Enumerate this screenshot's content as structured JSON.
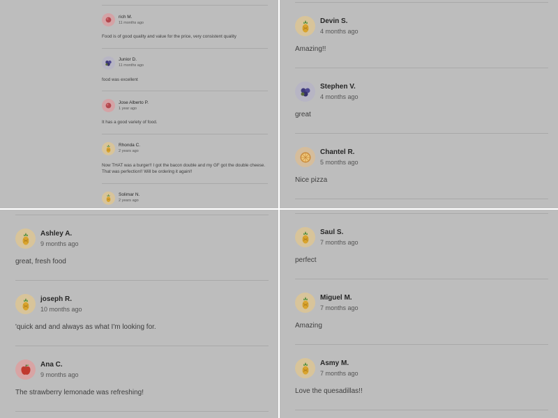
{
  "panels": [
    {
      "reviews": [
        {
          "name": "rich M.",
          "time": "11 months ago",
          "text": "Food is of good quality and value for the price, very consistent quality",
          "icon": "cherry-icon"
        },
        {
          "name": "Junior D.",
          "time": "11 months ago",
          "text": "food was excellent",
          "icon": "blueberry-icon"
        },
        {
          "name": "Jose Alberto P.",
          "time": "1 year ago",
          "text": "It has a good variety of food.",
          "icon": "cherry-icon"
        },
        {
          "name": "Rhonda C.",
          "time": "2 years ago",
          "text": "Now THAT was a burger!! I got the bacon double and my GF got the double cheese. That was perfection!! Will be ordering it again!!",
          "icon": "pineapple-icon"
        },
        {
          "name": "Solimar N.",
          "time": "2 years ago",
          "text": "",
          "icon": "pineapple-icon"
        }
      ]
    },
    {
      "reviews": [
        {
          "name": "Devin S.",
          "time": "4 months ago",
          "text": "Amazing!!",
          "icon": "pineapple-icon"
        },
        {
          "name": "Stephen V.",
          "time": "4 months ago",
          "text": "great",
          "icon": "blueberry-icon"
        },
        {
          "name": "Chantel R.",
          "time": "5 months ago",
          "text": "Nice pizza",
          "icon": "pizza-icon"
        }
      ]
    },
    {
      "reviews": [
        {
          "name": "Ashley A.",
          "time": "9 months ago",
          "text": "great, fresh food",
          "icon": "pineapple-icon"
        },
        {
          "name": "joseph R.",
          "time": "10 months ago",
          "text": "'quick and and always as what I'm looking for.",
          "icon": "pineapple-icon"
        },
        {
          "name": "Ana C.",
          "time": "9 months ago",
          "text": "The strawberry lemonade was refreshing!",
          "icon": "apple-icon"
        }
      ]
    },
    {
      "reviews": [
        {
          "name": "Saul S.",
          "time": "7 months ago",
          "text": "perfect",
          "icon": "pineapple-icon"
        },
        {
          "name": "Miguel M.",
          "time": "7 months ago",
          "text": "Amazing",
          "icon": "pineapple-icon"
        },
        {
          "name": "Asmy M.",
          "time": "7 months ago",
          "text": "Love the quesadillas!!",
          "icon": "pineapple-icon"
        }
      ]
    }
  ],
  "colors": {
    "overlay_gray": "#bdbdbd",
    "divider": "#a9a9a9",
    "name_text": "#262626",
    "meta_text": "#555555"
  }
}
